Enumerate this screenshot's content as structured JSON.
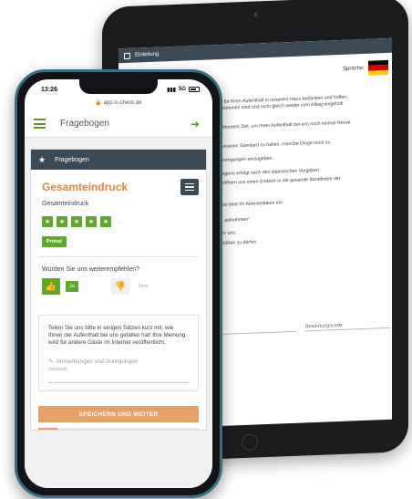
{
  "tablet": {
    "header_title": "Einleitung",
    "language_label": "Sprache:",
    "flag_colors": [
      "#000000",
      "#dd0000",
      "#ffce00"
    ],
    "paragraphs": [
      "rzlich für Ihren Aufenthalt in unserem Haus bedanken und hoffen,",
      "angekommen sind und nicht gleich wieder vom Alltag eingeholt",
      "hren Moment Zeit, um Ihren Aufenthalt bei uns noch einmal Revue",
      "lich, unseren Standard zu halten, manche Dinge noch zu",
      "und Anregungen einzugeben.",
      "agebogens erfolgt nach rein statistischen Vorgaben.",
      "ten eröffnen uns einen Einblick in die gesamte Bandbreite der",
      "gte.",
      "gen Sie bitte Ihr Abreisedatum ein.",
      "utton „teilnehmen\".",
      "eueren uns,",
      "s begrüßen zu dürfen."
    ],
    "fields": [
      "",
      "Bewertungscode"
    ]
  },
  "phone": {
    "time": "13:26",
    "signal": "5G",
    "url": "app.ic-check.de",
    "app_title": "Fragebogen",
    "card_header": "Fragebogen",
    "section_title": "Gesamteindruck",
    "rating_label": "Gesamteindruck",
    "rating_value": 5,
    "rating_max": 6,
    "rating_badge": "Primal",
    "question": "Würden Sie uns weiterempfehlen?",
    "yes_label": "Ja",
    "no_label": "Nein",
    "panel_text": "Teilen Sie uns bitte in einigen Sätzen kurz mit, wie Ihnen der Aufenthalt bei uns gefallen hat! Ihre Meinung wird für andere Gäste im Internet veröffentlicht.",
    "textarea_label": "Anmerkungen und Anregungen",
    "textarea_sub": "(optional)",
    "save_button": "SPEICHERN UND WEITER",
    "progress": 0.12,
    "accent_green": "#5ea82b",
    "accent_orange": "#e3873a",
    "header_dark": "#3b4a55"
  }
}
